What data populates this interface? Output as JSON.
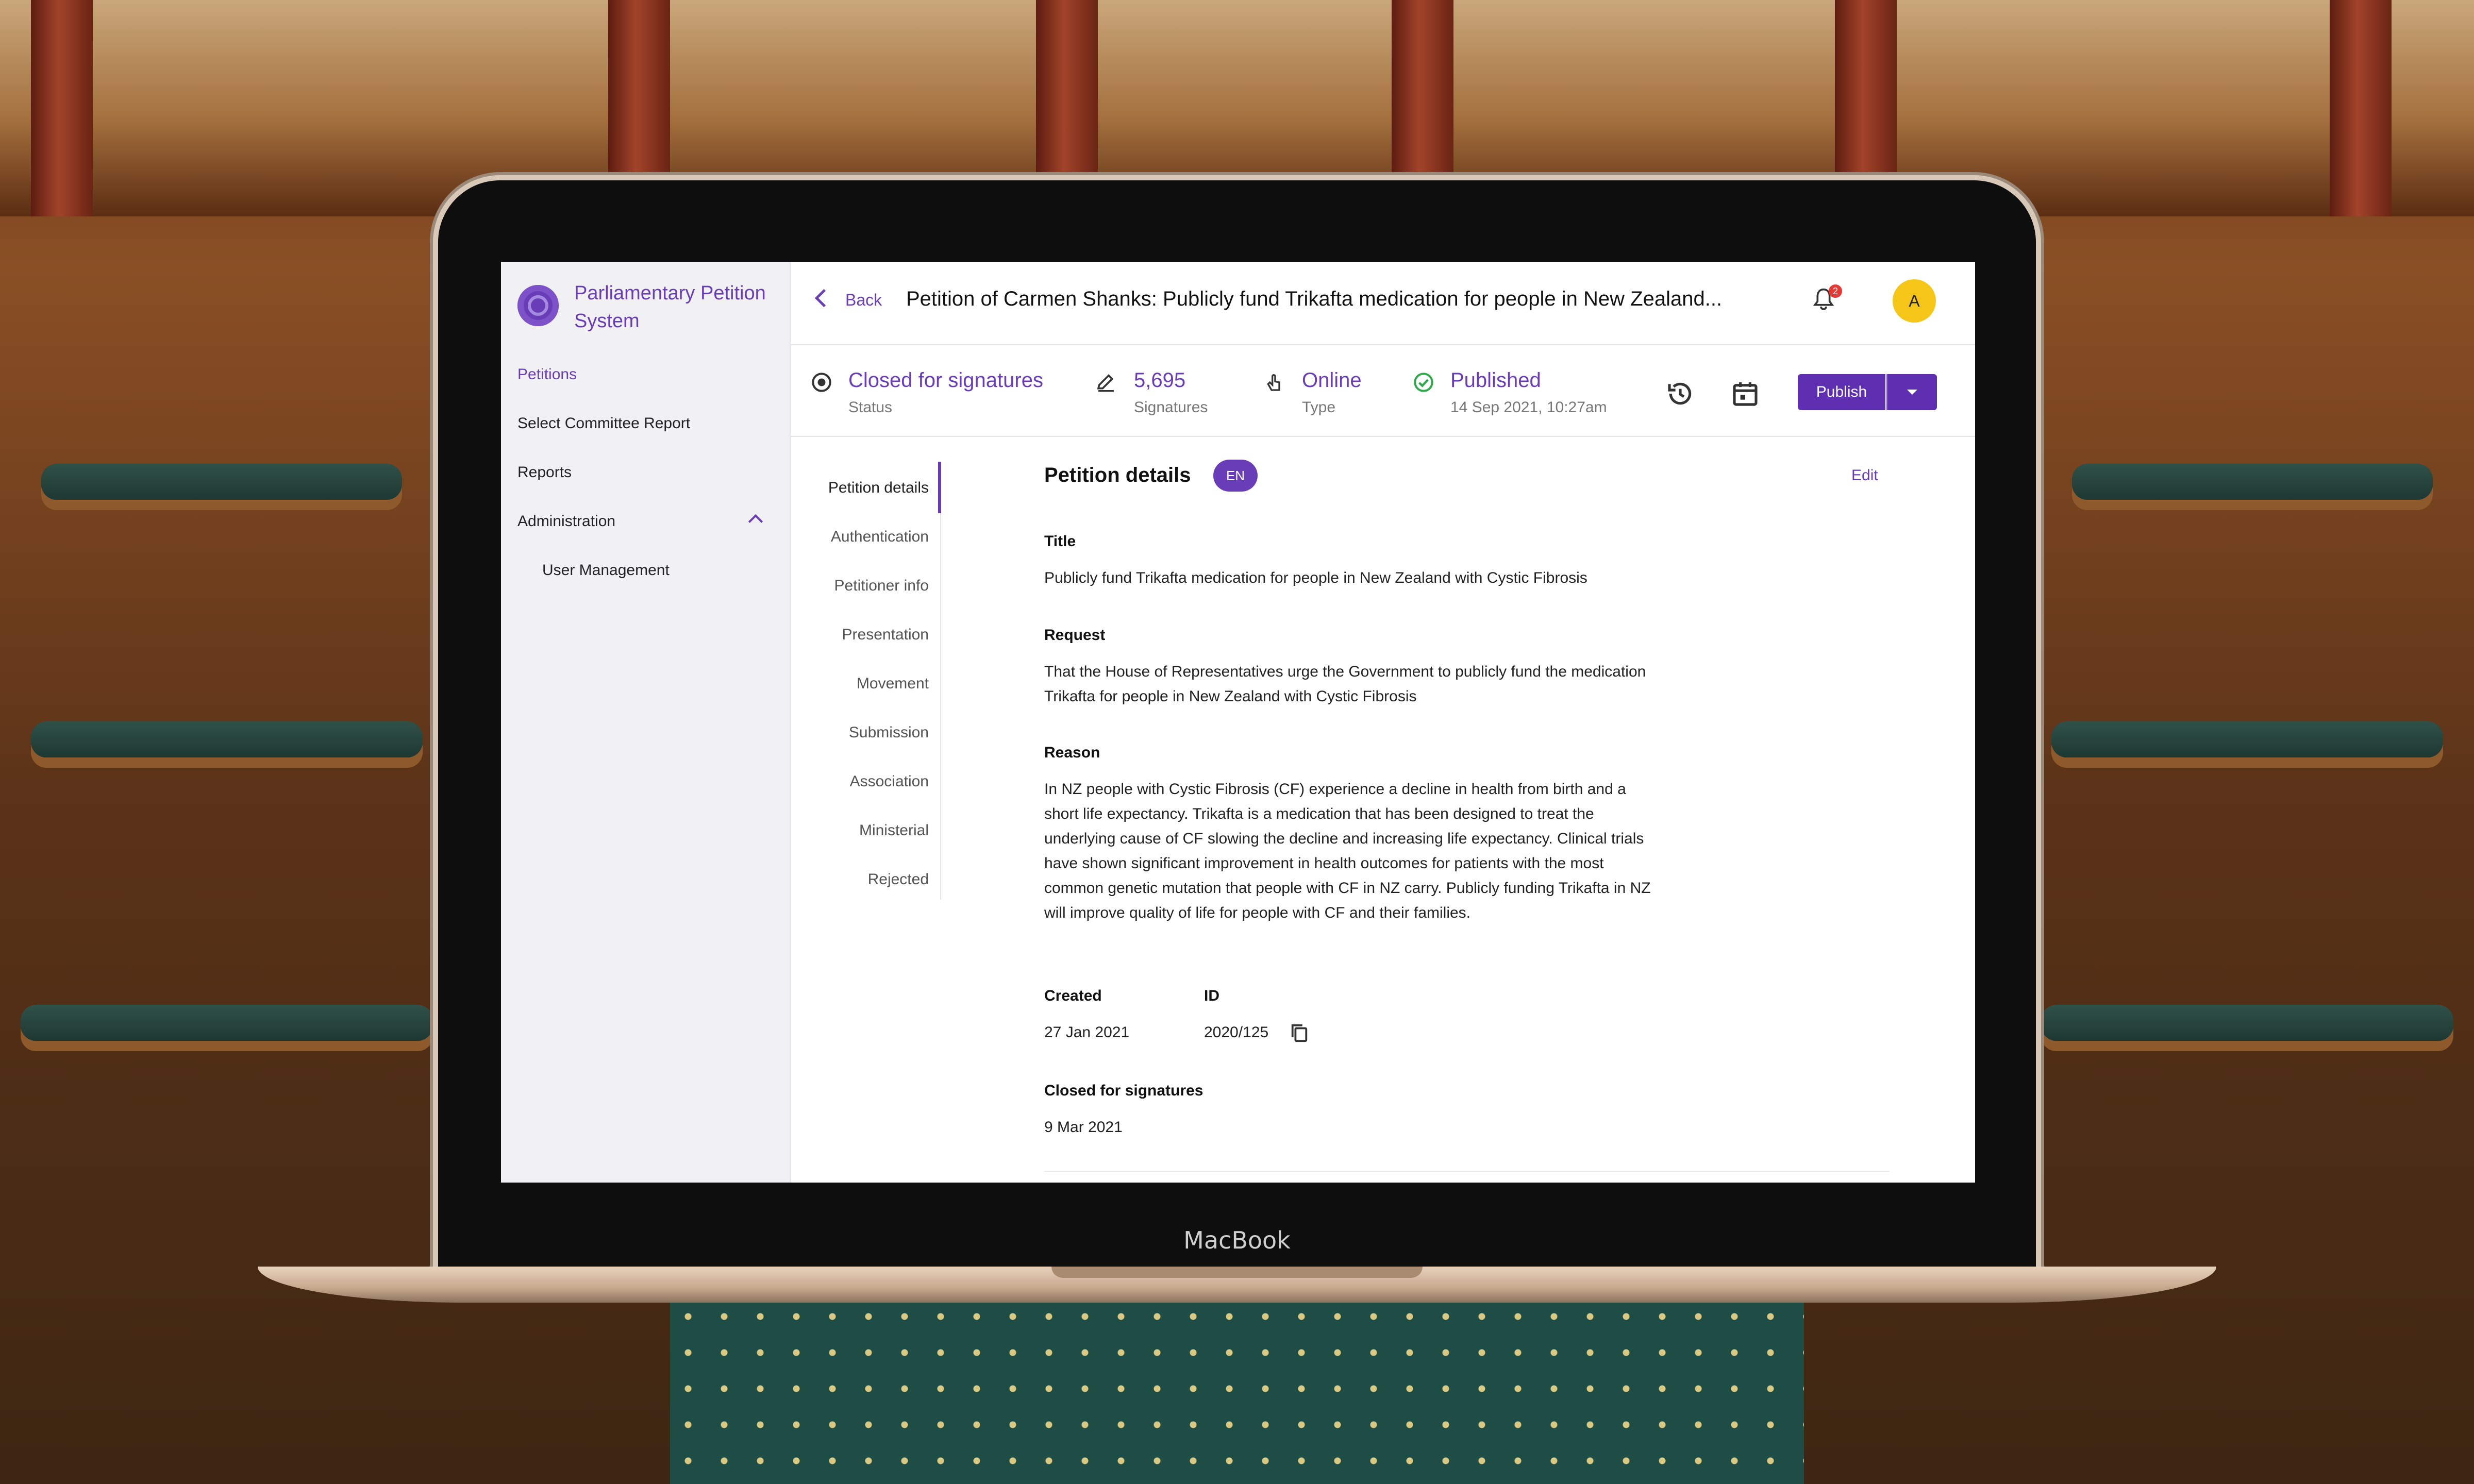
{
  "app": {
    "title": "Parliamentary Petition System",
    "device_brand": "MacBook",
    "accent_color": "#6a3db8"
  },
  "sidebar": {
    "items": [
      {
        "label": "Petitions",
        "active": true
      },
      {
        "label": "Select Committee Report"
      },
      {
        "label": "Reports"
      },
      {
        "label": "Administration",
        "expanded": true
      },
      {
        "label": "User Management",
        "sub": true
      }
    ]
  },
  "header": {
    "back_label": "Back",
    "petition_title": "Petition of Carmen Shanks: Publicly fund Trikafta medication for people in New Zealand...",
    "notification_count": "2",
    "avatar_initial": "A"
  },
  "status": {
    "status_value": "Closed for signatures",
    "status_label": "Status",
    "signatures_value": "5,695",
    "signatures_label": "Signatures",
    "type_value": "Online",
    "type_label": "Type",
    "published_value": "Published",
    "published_date": "14 Sep 2021, 10:27am",
    "publish_button": "Publish"
  },
  "section_nav": [
    "Petition details",
    "Authentication",
    "Petitioner info",
    "Presentation",
    "Movement",
    "Submission",
    "Association",
    "Ministerial",
    "Rejected"
  ],
  "details": {
    "heading": "Petition details",
    "language": "EN",
    "edit_label": "Edit",
    "title_label": "Title",
    "title_value": "Publicly fund Trikafta medication for people in New Zealand with Cystic Fibrosis",
    "request_label": "Request",
    "request_value": "That the House of Representatives urge the Government to publicly fund the medication Trikafta for people in New Zealand with Cystic Fibrosis",
    "reason_label": "Reason",
    "reason_value": "In NZ people with Cystic Fibrosis (CF) experience a decline in health from birth and a short life expectancy. Trikafta is a medication that has been designed to treat the underlying cause of CF slowing the decline and increasing life expectancy. Clinical trials have shown significant improvement in health outcomes for patients with the most common genetic mutation that people with CF in NZ carry. Publicly funding Trikafta in NZ will improve quality of life for people with CF and their families.",
    "created_label": "Created",
    "created_value": "27 Jan 2021",
    "id_label": "ID",
    "id_value": "2020/125",
    "closed_label": "Closed for signatures",
    "closed_value": "9 Mar 2021"
  }
}
